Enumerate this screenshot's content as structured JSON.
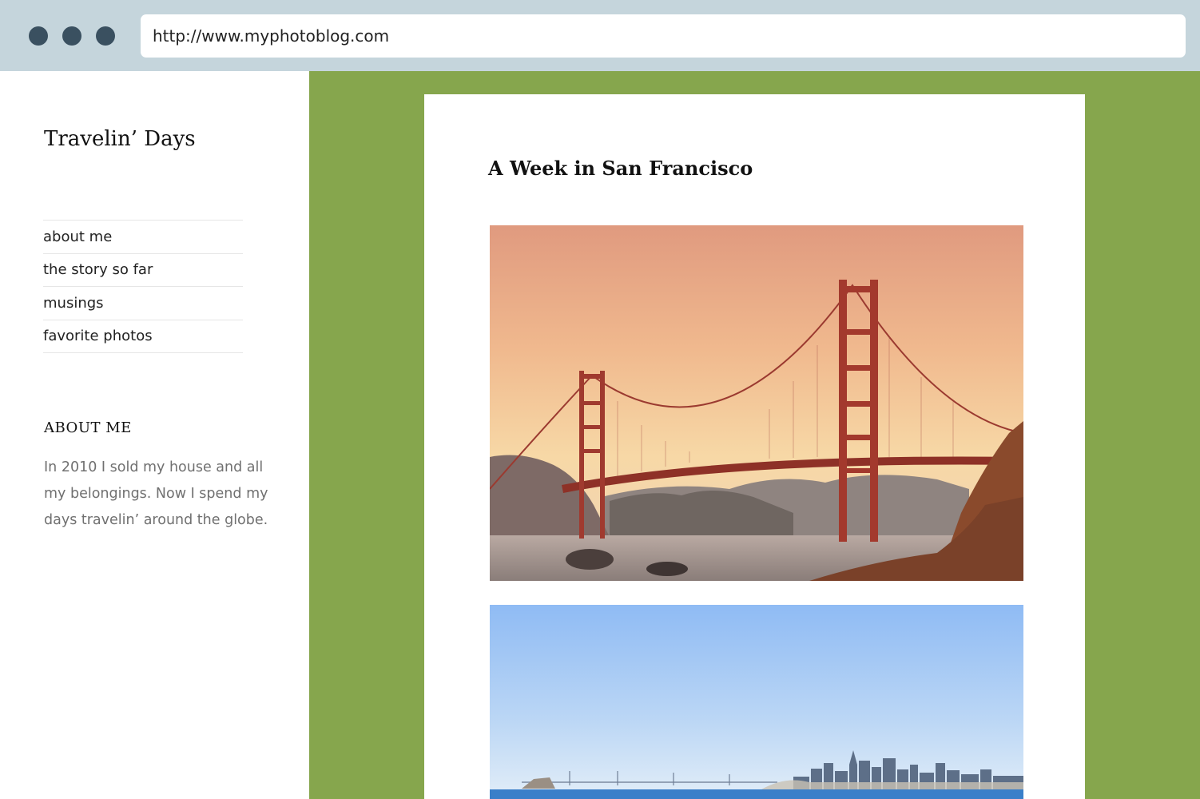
{
  "browser": {
    "url": "http://www.myphotoblog.com"
  },
  "sidebar": {
    "site_title": "Travelin’ Days",
    "nav_items": [
      {
        "label": "about me"
      },
      {
        "label": "the story so far"
      },
      {
        "label": "musings"
      },
      {
        "label": "favorite photos"
      }
    ],
    "widget": {
      "title": "ABOUT ME",
      "text": "In 2010 I sold my house and all my belongings. Now I spend my days travelin’ around the globe."
    }
  },
  "post": {
    "title": "A Week in San Francisco",
    "images": [
      {
        "name": "golden-gate-bridge-photo"
      },
      {
        "name": "san-francisco-skyline-photo"
      }
    ]
  },
  "colors": {
    "chrome": "#c5d5dc",
    "window_dots": "#3a5060",
    "main_background": "#86a64d"
  }
}
